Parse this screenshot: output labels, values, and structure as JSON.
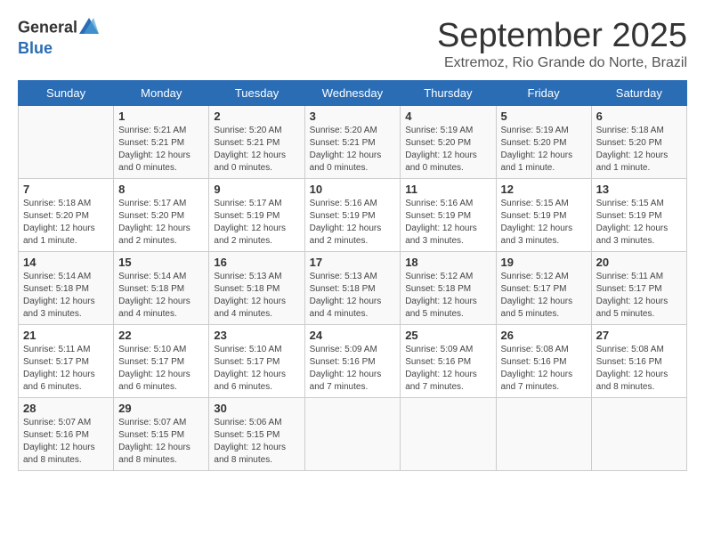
{
  "header": {
    "logo_line1": "General",
    "logo_line2": "Blue",
    "month": "September 2025",
    "location": "Extremoz, Rio Grande do Norte, Brazil"
  },
  "days_of_week": [
    "Sunday",
    "Monday",
    "Tuesday",
    "Wednesday",
    "Thursday",
    "Friday",
    "Saturday"
  ],
  "weeks": [
    [
      {
        "day": "",
        "info": ""
      },
      {
        "day": "1",
        "info": "Sunrise: 5:21 AM\nSunset: 5:21 PM\nDaylight: 12 hours\nand 0 minutes."
      },
      {
        "day": "2",
        "info": "Sunrise: 5:20 AM\nSunset: 5:21 PM\nDaylight: 12 hours\nand 0 minutes."
      },
      {
        "day": "3",
        "info": "Sunrise: 5:20 AM\nSunset: 5:21 PM\nDaylight: 12 hours\nand 0 minutes."
      },
      {
        "day": "4",
        "info": "Sunrise: 5:19 AM\nSunset: 5:20 PM\nDaylight: 12 hours\nand 0 minutes."
      },
      {
        "day": "5",
        "info": "Sunrise: 5:19 AM\nSunset: 5:20 PM\nDaylight: 12 hours\nand 1 minute."
      },
      {
        "day": "6",
        "info": "Sunrise: 5:18 AM\nSunset: 5:20 PM\nDaylight: 12 hours\nand 1 minute."
      }
    ],
    [
      {
        "day": "7",
        "info": "Sunrise: 5:18 AM\nSunset: 5:20 PM\nDaylight: 12 hours\nand 1 minute."
      },
      {
        "day": "8",
        "info": "Sunrise: 5:17 AM\nSunset: 5:20 PM\nDaylight: 12 hours\nand 2 minutes."
      },
      {
        "day": "9",
        "info": "Sunrise: 5:17 AM\nSunset: 5:19 PM\nDaylight: 12 hours\nand 2 minutes."
      },
      {
        "day": "10",
        "info": "Sunrise: 5:16 AM\nSunset: 5:19 PM\nDaylight: 12 hours\nand 2 minutes."
      },
      {
        "day": "11",
        "info": "Sunrise: 5:16 AM\nSunset: 5:19 PM\nDaylight: 12 hours\nand 3 minutes."
      },
      {
        "day": "12",
        "info": "Sunrise: 5:15 AM\nSunset: 5:19 PM\nDaylight: 12 hours\nand 3 minutes."
      },
      {
        "day": "13",
        "info": "Sunrise: 5:15 AM\nSunset: 5:19 PM\nDaylight: 12 hours\nand 3 minutes."
      }
    ],
    [
      {
        "day": "14",
        "info": "Sunrise: 5:14 AM\nSunset: 5:18 PM\nDaylight: 12 hours\nand 3 minutes."
      },
      {
        "day": "15",
        "info": "Sunrise: 5:14 AM\nSunset: 5:18 PM\nDaylight: 12 hours\nand 4 minutes."
      },
      {
        "day": "16",
        "info": "Sunrise: 5:13 AM\nSunset: 5:18 PM\nDaylight: 12 hours\nand 4 minutes."
      },
      {
        "day": "17",
        "info": "Sunrise: 5:13 AM\nSunset: 5:18 PM\nDaylight: 12 hours\nand 4 minutes."
      },
      {
        "day": "18",
        "info": "Sunrise: 5:12 AM\nSunset: 5:18 PM\nDaylight: 12 hours\nand 5 minutes."
      },
      {
        "day": "19",
        "info": "Sunrise: 5:12 AM\nSunset: 5:17 PM\nDaylight: 12 hours\nand 5 minutes."
      },
      {
        "day": "20",
        "info": "Sunrise: 5:11 AM\nSunset: 5:17 PM\nDaylight: 12 hours\nand 5 minutes."
      }
    ],
    [
      {
        "day": "21",
        "info": "Sunrise: 5:11 AM\nSunset: 5:17 PM\nDaylight: 12 hours\nand 6 minutes."
      },
      {
        "day": "22",
        "info": "Sunrise: 5:10 AM\nSunset: 5:17 PM\nDaylight: 12 hours\nand 6 minutes."
      },
      {
        "day": "23",
        "info": "Sunrise: 5:10 AM\nSunset: 5:17 PM\nDaylight: 12 hours\nand 6 minutes."
      },
      {
        "day": "24",
        "info": "Sunrise: 5:09 AM\nSunset: 5:16 PM\nDaylight: 12 hours\nand 7 minutes."
      },
      {
        "day": "25",
        "info": "Sunrise: 5:09 AM\nSunset: 5:16 PM\nDaylight: 12 hours\nand 7 minutes."
      },
      {
        "day": "26",
        "info": "Sunrise: 5:08 AM\nSunset: 5:16 PM\nDaylight: 12 hours\nand 7 minutes."
      },
      {
        "day": "27",
        "info": "Sunrise: 5:08 AM\nSunset: 5:16 PM\nDaylight: 12 hours\nand 8 minutes."
      }
    ],
    [
      {
        "day": "28",
        "info": "Sunrise: 5:07 AM\nSunset: 5:16 PM\nDaylight: 12 hours\nand 8 minutes."
      },
      {
        "day": "29",
        "info": "Sunrise: 5:07 AM\nSunset: 5:15 PM\nDaylight: 12 hours\nand 8 minutes."
      },
      {
        "day": "30",
        "info": "Sunrise: 5:06 AM\nSunset: 5:15 PM\nDaylight: 12 hours\nand 8 minutes."
      },
      {
        "day": "",
        "info": ""
      },
      {
        "day": "",
        "info": ""
      },
      {
        "day": "",
        "info": ""
      },
      {
        "day": "",
        "info": ""
      }
    ]
  ]
}
